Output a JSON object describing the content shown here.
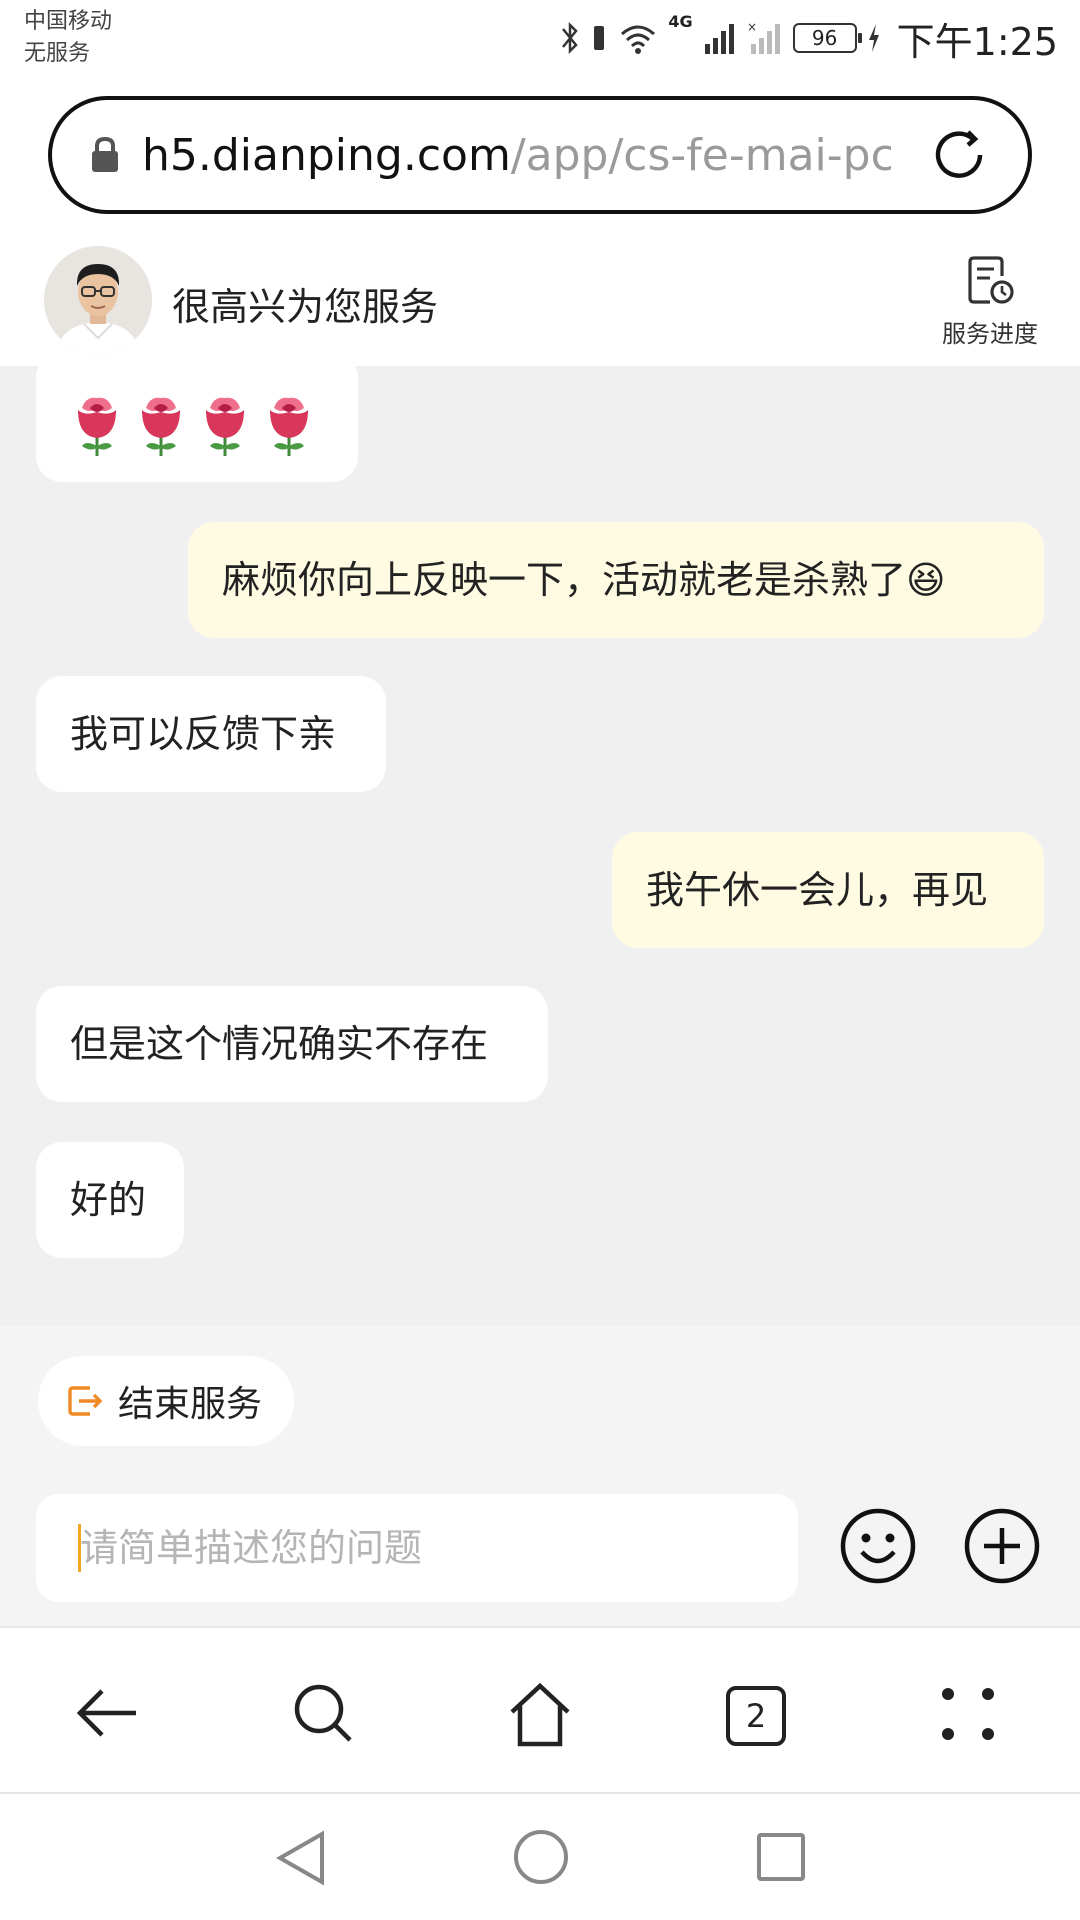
{
  "status_bar": {
    "carrier": "中国移动",
    "service": "无服务",
    "network": "4G",
    "battery": "96",
    "time": "下午1:25"
  },
  "address_bar": {
    "domain": "h5.dianping.com",
    "path": "/app/cs-fe-mai-pc"
  },
  "chat_header": {
    "greeting": "很高兴为您服务",
    "progress_label": "服务进度"
  },
  "messages": [
    {
      "from": "agent",
      "text": "🌹🌹🌹🌹"
    },
    {
      "from": "user",
      "text": "麻烦你向上反映一下，活动就老是杀熟了😆"
    },
    {
      "from": "agent",
      "text": "我可以反馈下亲"
    },
    {
      "from": "user",
      "text": "我午休一会儿，再见"
    },
    {
      "from": "agent",
      "text": "但是这个情况确实不存在"
    },
    {
      "from": "agent",
      "text": "好的"
    }
  ],
  "input_area": {
    "end_service_label": "结束服务",
    "placeholder": "请简单描述您的问题"
  },
  "browser_toolbar": {
    "tab_count": "2"
  },
  "colors": {
    "user_bubble": "#fffbe3",
    "agent_bubble": "#ffffff",
    "chat_background": "#f0f0f0",
    "accent_orange": "#f5a623"
  }
}
